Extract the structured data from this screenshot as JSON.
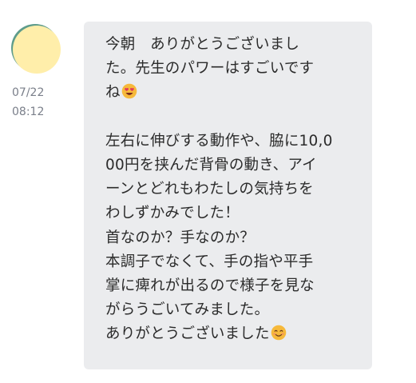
{
  "message": {
    "timestamp_date": "07/22",
    "timestamp_time": "08:12",
    "lines": [
      "今朝　ありがとうございまし",
      "た。先生のパワーはすごいです",
      "ね",
      "",
      "左右に伸びする動作や、脇に10,0",
      "00円を挟んだ背骨の動き、アイ",
      "ーンとどれもわたしの気持ちを",
      "わしずかみでした！",
      "首なのか？手なのか？",
      "本調子でなくて、手の指や平手",
      "掌に痺れが出るので様子を見な",
      "がらうごいてみました。",
      "ありがとうございました"
    ],
    "emoji_1": "heart-eyes-emoji",
    "emoji_2": "smiling-face-emoji"
  },
  "colors": {
    "bubble": "#ebecee",
    "avatar_fill": "#ffeeaa",
    "avatar_ring": "#5e9c8b",
    "timestamp": "#7a7f8a",
    "text": "#2b2b2b"
  }
}
